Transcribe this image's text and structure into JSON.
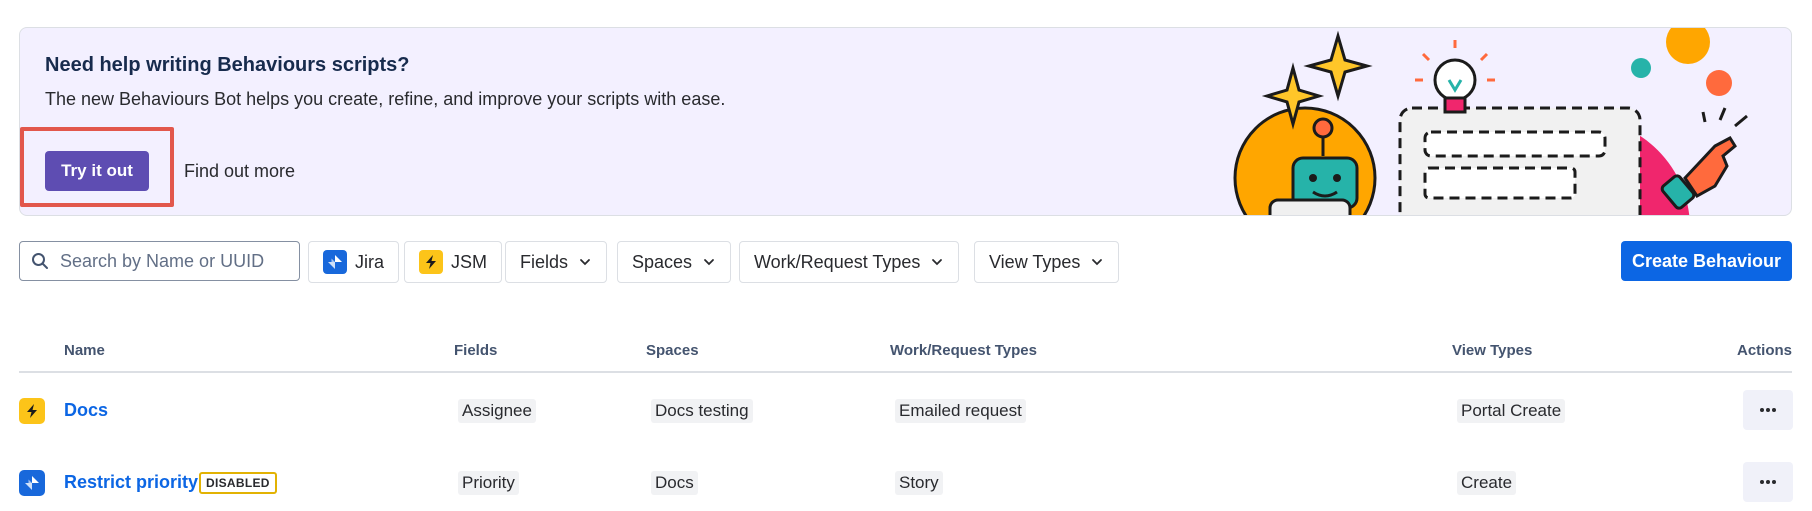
{
  "banner": {
    "title": "Need help writing Behaviours scripts?",
    "description": "The new Behaviours Bot helps you create, refine, and improve your scripts with ease.",
    "primary_label": "Try it out",
    "secondary_label": "Find out more",
    "highlight_color": "#e2574c"
  },
  "toolbar": {
    "search_placeholder": "Search by Name or UUID",
    "jira_label": "Jira",
    "jsm_label": "JSM",
    "fields_label": "Fields",
    "spaces_label": "Spaces",
    "work_types_label": "Work/Request Types",
    "view_types_label": "View Types",
    "create_label": "Create Behaviour"
  },
  "table": {
    "columns": [
      "Name",
      "Fields",
      "Spaces",
      "Work/Request Types",
      "View Types",
      "Actions"
    ],
    "rows": [
      {
        "product": "JSM",
        "name": "Docs",
        "badge": "",
        "field": "Assignee",
        "space": "Docs testing",
        "work_type": "Emailed request",
        "view_type": "Portal Create"
      },
      {
        "product": "Jira",
        "name": "Restrict priority",
        "badge": "DISABLED",
        "field": "Priority",
        "space": "Docs",
        "work_type": "Story",
        "view_type": "Create"
      }
    ]
  },
  "colors": {
    "brand_purple": "#5e4db2",
    "primary_blue": "#0c66e4",
    "jira_blue": "#1868db",
    "jsm_yellow": "#fcc419"
  }
}
